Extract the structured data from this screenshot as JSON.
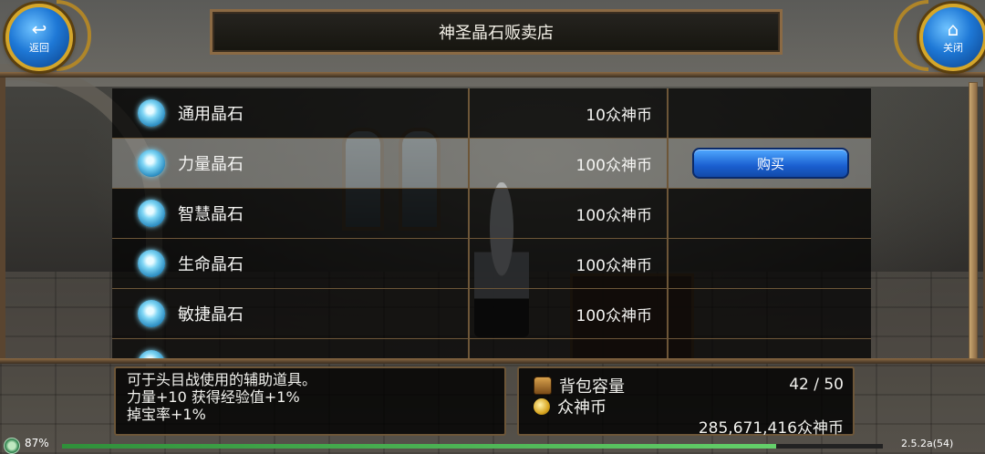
{
  "title": "神圣晶石贩卖店",
  "back_button": {
    "icon": "↩",
    "label": "返回"
  },
  "close_button": {
    "icon": "⌂",
    "label": "关闭"
  },
  "items": [
    {
      "name": "通用晶石",
      "price": "10众神币",
      "selected": false
    },
    {
      "name": "力量晶石",
      "price": "100众神币",
      "selected": true,
      "buy_label": "购买"
    },
    {
      "name": "智慧晶石",
      "price": "100众神币",
      "selected": false
    },
    {
      "name": "生命晶石",
      "price": "100众神币",
      "selected": false
    },
    {
      "name": "敏捷晶石",
      "price": "100众神币",
      "selected": false
    }
  ],
  "description": {
    "line1": "可于头目战使用的辅助道具。",
    "line2": "力量+10 获得经验值+1%",
    "line3": "掉宝率+1%"
  },
  "stats": {
    "bag_label": "背包容量",
    "bag_value": "42 / 50",
    "currency_label": "众神币",
    "currency_value": "285,671,416众神币"
  },
  "status_bar": {
    "battery": "87%",
    "version": "2.5.2a(54)",
    "progress_fraction": 0.87
  }
}
